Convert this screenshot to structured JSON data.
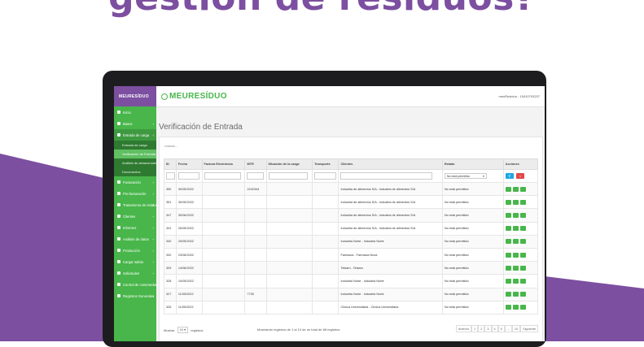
{
  "headline": "gestión de residuos?",
  "colors": {
    "brand_purple": "#7c4fa0",
    "brand_green": "#48b64a"
  },
  "sidebar": {
    "brand": "MEURESÍDUO",
    "items": [
      {
        "label": "Inicio",
        "icon": "home-icon"
      },
      {
        "label": "Bases",
        "icon": "database-icon"
      },
      {
        "label": "Entrada de carga",
        "icon": "arrow-in-icon"
      },
      {
        "label": "Facturación",
        "icon": "invoice-icon"
      },
      {
        "label": "Pre-facturación",
        "icon": "file-icon"
      },
      {
        "label": "Tratamiento de residuos",
        "icon": "recycle-icon"
      },
      {
        "label": "Clientes",
        "icon": "users-icon"
      },
      {
        "label": "Informes",
        "icon": "report-icon"
      },
      {
        "label": "Análisis de datos",
        "icon": "chart-icon"
      },
      {
        "label": "Producción",
        "icon": "gear-icon"
      },
      {
        "label": "Cargar salida",
        "icon": "upload-icon"
      },
      {
        "label": "Solicitudes",
        "icon": "request-icon"
      },
      {
        "label": "Control de contenedores",
        "icon": "container-icon"
      },
      {
        "label": "Registros Generales",
        "icon": "list-icon"
      }
    ],
    "sub_items": [
      {
        "label": "Entrada de carga"
      },
      {
        "label": "Verificación de Entrada"
      },
      {
        "label": "Análisis de almacenamiento"
      },
      {
        "label": "Documentos"
      }
    ]
  },
  "topbar": {
    "logo": "MEURESÍDUO",
    "user": "meuResiduo - 15410793237"
  },
  "page_title": "Verificación de Entrada",
  "loading_text": "Listado...",
  "table": {
    "headers": [
      "ID",
      "Fecha",
      "Factura Electrónica",
      "MTR",
      "Situación de la carga",
      "Transporte",
      "Clientes",
      "Estado",
      "Acciones"
    ],
    "filter_select": "No está permitido",
    "rows": [
      {
        "id": "350",
        "fecha": "30/05/2022",
        "factura": "",
        "mtr": "2242344",
        "situacion": "",
        "transporte": "",
        "cliente": "Industria de alimentos S/A - Industria de alimentos S/A",
        "estado": "No está permitido"
      },
      {
        "id": "351",
        "fecha": "30/05/2022",
        "factura": "",
        "mtr": "",
        "situacion": "",
        "transporte": "",
        "cliente": "Industria de alimentos S/A - Industria de alimentos S/A",
        "estado": "No está permitido"
      },
      {
        "id": "347",
        "fecha": "30/06/2022",
        "factura": "",
        "mtr": "",
        "situacion": "",
        "transporte": "",
        "cliente": "Industria de alimentos S/A - Industria de alimentos S/A",
        "estado": "No está permitido"
      },
      {
        "id": "341",
        "fecha": "26/05/2022",
        "factura": "",
        "mtr": "",
        "situacion": "",
        "transporte": "",
        "cliente": "Industria de alimentos S/A - Industria de alimentos S/A",
        "estado": "No está permitido"
      },
      {
        "id": "340",
        "fecha": "20/05/2022",
        "factura": "",
        "mtr": "",
        "situacion": "",
        "transporte": "",
        "cliente": "Industria Norte - Industria Norte",
        "estado": "No está permitido"
      },
      {
        "id": "332",
        "fecha": "23/06/2022",
        "factura": "",
        "mtr": "",
        "situacion": "",
        "transporte": "",
        "cliente": "Farmacia - Farmacia Nova",
        "estado": "No está permitido"
      },
      {
        "id": "329",
        "fecha": "14/06/2022",
        "factura": "",
        "mtr": "",
        "situacion": "",
        "transporte": "",
        "cliente": "Telsam - Telsam",
        "estado": "No está permitido"
      },
      {
        "id": "328",
        "fecha": "10/05/2022",
        "factura": "",
        "mtr": "",
        "situacion": "",
        "transporte": "",
        "cliente": "Industria Norte - Industria Norte",
        "estado": "No está permitido"
      },
      {
        "id": "327",
        "fecha": "11/05/2022",
        "factura": "",
        "mtr": "7730",
        "situacion": "",
        "transporte": "",
        "cliente": "Industria Norte - Industria Norte",
        "estado": "No está permitido"
      },
      {
        "id": "326",
        "fecha": "11/05/2022",
        "factura": "",
        "mtr": "",
        "situacion": "",
        "transporte": "",
        "cliente": "Clínica Universitária - Clínica Universitária",
        "estado": "No está permitido"
      }
    ]
  },
  "footer": {
    "show_label": "Mostrar",
    "page_size": "10",
    "records_label": "registros",
    "info": "Mostrando registros de 1 al 10 de un total de 88 registros",
    "pager": [
      "Anterior",
      "1",
      "2",
      "3",
      "4",
      "5",
      "...",
      "10",
      "Siguiente"
    ]
  }
}
